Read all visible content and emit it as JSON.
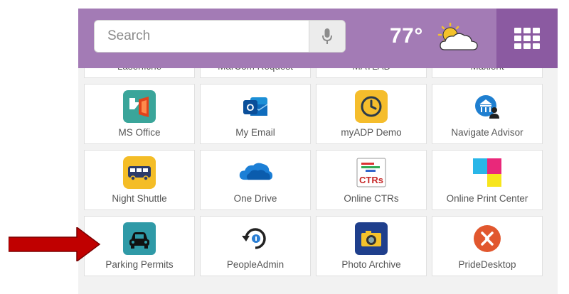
{
  "header": {
    "search": {
      "placeholder": "Search",
      "value": ""
    },
    "temperature": "77°",
    "weather_icon": "partly-cloudy-icon",
    "apps_icon": "apps-grid-icon",
    "colors": {
      "header": "#a37bb5",
      "apps_button": "#8b5aa1"
    }
  },
  "tiles": [
    {
      "label": "Laserfiche",
      "icon": "laserfiche-icon"
    },
    {
      "label": "MarCom Request",
      "icon": "marcom-icon"
    },
    {
      "label": "MATLAB",
      "icon": "matlab-icon"
    },
    {
      "label": "Maxient",
      "icon": "maxient-icon"
    },
    {
      "label": "MS Office",
      "icon": "ms-office-icon"
    },
    {
      "label": "My Email",
      "icon": "outlook-icon"
    },
    {
      "label": "myADP Demo",
      "icon": "clock-icon"
    },
    {
      "label": "Navigate Advisor",
      "icon": "navigate-icon"
    },
    {
      "label": "Night Shuttle",
      "icon": "shuttle-bus-icon"
    },
    {
      "label": "One Drive",
      "icon": "onedrive-cloud-icon"
    },
    {
      "label": "Online CTRs",
      "icon": "ctrs-icon"
    },
    {
      "label": "Online Print Center",
      "icon": "print-center-icon"
    },
    {
      "label": "Parking Permits",
      "icon": "car-icon"
    },
    {
      "label": "PeopleAdmin",
      "icon": "peopleadmin-icon"
    },
    {
      "label": "Photo Archive",
      "icon": "camera-icon"
    },
    {
      "label": "PrideDesktop",
      "icon": "pride-desktop-icon"
    }
  ],
  "annotation": {
    "arrow_color": "#c00000",
    "icon": "red-arrow-icon"
  }
}
